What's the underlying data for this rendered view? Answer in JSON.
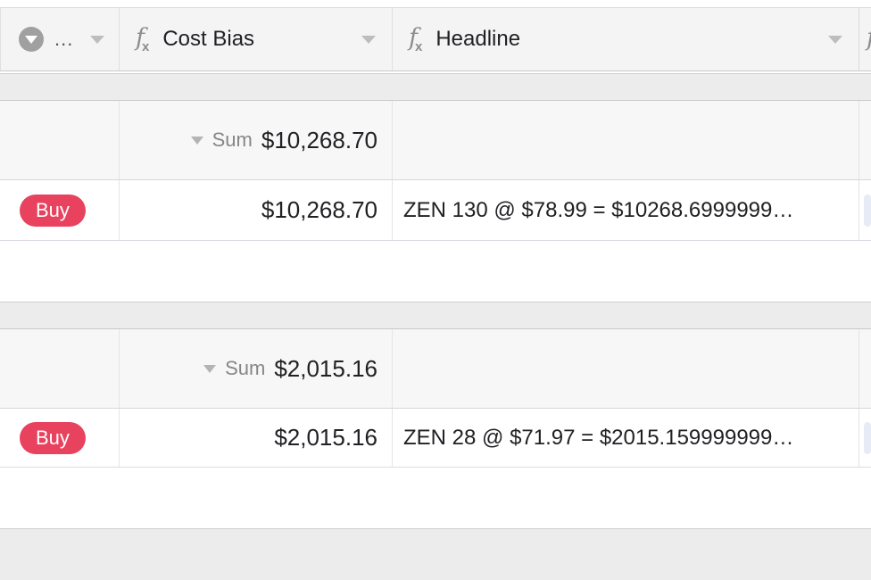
{
  "columns": [
    {
      "id": "category",
      "icon": "filter-circle-icon",
      "label": "...",
      "has_menu": true
    },
    {
      "id": "cost_bias",
      "icon": "fx-icon",
      "label": "Cost Bias",
      "has_menu": true
    },
    {
      "id": "headline",
      "icon": "fx-icon",
      "label": "Headline",
      "has_menu": true
    },
    {
      "id": "next_partial",
      "icon": "fx-icon",
      "label": "",
      "has_menu": false
    }
  ],
  "aggregate_label": "Sum",
  "groups": [
    {
      "summary": {
        "label": "Sum",
        "cost_bias": "$10,268.70"
      },
      "rows": [
        {
          "category_badge": "Buy",
          "cost_bias": "$10,268.70",
          "headline": "ZEN 130 @ $78.99 = $10268.6999999…"
        }
      ]
    },
    {
      "summary": {
        "label": "Sum",
        "cost_bias": "$2,015.16"
      },
      "rows": [
        {
          "category_badge": "Buy",
          "cost_bias": "$2,015.16",
          "headline": "ZEN 28 @ $71.97 = $2015.159999999…"
        }
      ]
    }
  ],
  "colors": {
    "badge_buy_bg": "#e8425e",
    "badge_buy_text": "#ffffff",
    "header_bg": "#f4f4f5",
    "band_bg": "#ececec",
    "summary_row_bg": "#f7f7f7",
    "row_bg": "#ffffff",
    "text_primary": "#202124",
    "text_muted": "#85868a",
    "chip_partial_bg": "#e7ebf6"
  }
}
